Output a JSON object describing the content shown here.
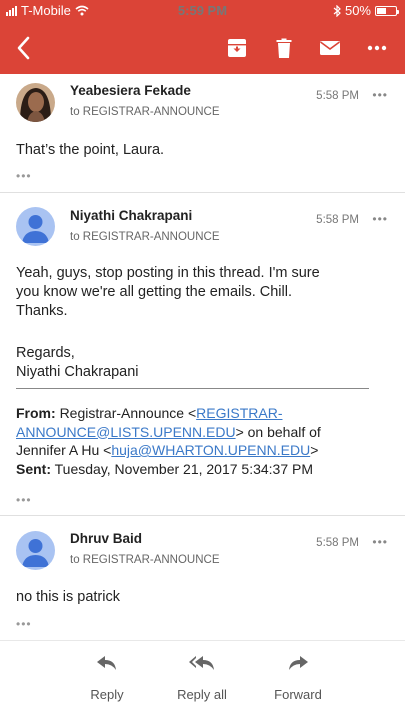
{
  "status_bar": {
    "carrier": "T-Mobile",
    "time": "5:59 PM",
    "battery": "50%",
    "battery_level": 0.5
  },
  "toolbar": {
    "icons": [
      "back-arrow-icon",
      "archive-icon",
      "trash-icon",
      "mail-icon",
      "more-icon"
    ]
  },
  "messages": [
    {
      "sender": "Yeabesiera Fekade",
      "to": "to REGISTRAR-ANNOUNCE",
      "time": "5:58 PM",
      "body": "That’s the point, Laura."
    },
    {
      "sender": "Niyathi Chakrapani",
      "to": "to REGISTRAR-ANNOUNCE",
      "time": "5:58 PM",
      "body_lines": [
        "Yeah, guys, stop posting in this thread. I'm sure",
        "you know we're all getting the emails. Chill.",
        "Thanks."
      ],
      "regards": "Regards,",
      "signature": "Niyathi Chakrapani",
      "quoted": {
        "from_label": "From:",
        "from_name": "Registrar-Announce <",
        "from_link_1": "REGISTRAR-",
        "from_link_2": "ANNOUNCE@LISTS.UPENN.EDU",
        "behalf": "> on behalf of",
        "behalf_name": "Jennifer A Hu <",
        "behalf_link": "huja@WHARTON.UPENN.EDU",
        "behalf_end": ">",
        "sent_label": "Sent:",
        "sent_value": "Tuesday, November 21, 2017 5:34:37 PM"
      }
    },
    {
      "sender": "Dhruv Baid",
      "to": "to REGISTRAR-ANNOUNCE",
      "time": "5:58 PM",
      "body": "no this is patrick"
    }
  ],
  "bottom_bar": {
    "reply": "Reply",
    "reply_all": "Reply all",
    "forward": "Forward"
  },
  "colors": {
    "header": "#db4437",
    "link": "#3b79c8",
    "avatar": "#a9c3f2",
    "avatar_person": "#3f72d6"
  }
}
